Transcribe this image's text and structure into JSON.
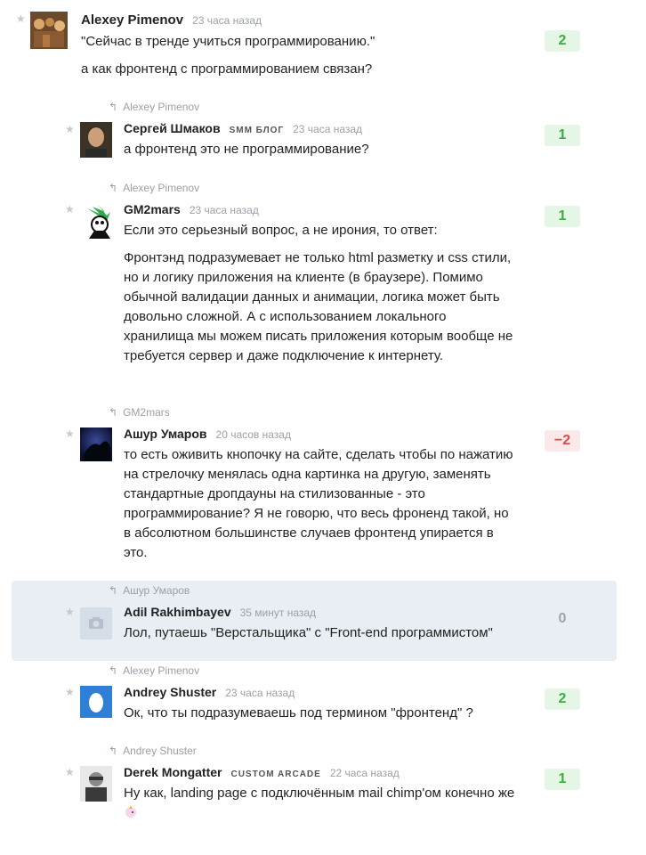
{
  "comments": [
    {
      "author": "Alexey Pimenov",
      "time": "23 часа назад",
      "score": "2",
      "p1": "\"Сейчас в тренде учиться программированию.\"",
      "p2": "а как фронтенд с программированием связан?"
    },
    {
      "reply_to": "Alexey Pimenov",
      "author": "Сергей Шмаков",
      "blog": "SMM БЛОГ",
      "time": "23 часа назад",
      "score": "1",
      "p1": "а фронтенд это не программирование?"
    },
    {
      "reply_to": "Alexey Pimenov",
      "author": "GM2mars",
      "time": "23 часа назад",
      "score": "1",
      "p1": "Если это серьезный вопрос, а не ирония, то ответ:",
      "p2": "Фронтэнд подразумевает не только html разметку и css стили, но и логику приложения на клиенте (в браузере). Помимо обычной валидации данных и анимации, логика может быть довольно сложной. А с использованием локального хранилища мы можем писать приложения которым вообще не требуется сервер и даже подключение к интернету."
    },
    {
      "reply_to": "GM2mars",
      "author": "Ашур Умаров",
      "time": "20 часов назад",
      "score": "−2",
      "p1": "то есть оживить кнопочку на сайте, сделать чтобы по нажатию на стрелочку менялась одна картинка на другую, заменять стандартные дропдауны на стилизованные - это программирование? Я не говорю, что весь фроненд такой, но в абсолютном большинстве случаев фронтенд упирается в это."
    },
    {
      "reply_to": "Ашур Умаров",
      "author": "Adil Rakhimbayev",
      "time": "35 минут назад",
      "score": "0",
      "p1": "Лол, путаешь \"Верстальщика\" с \"Front-end программистом\""
    },
    {
      "reply_to": "Alexey Pimenov",
      "author": "Andrey Shuster",
      "time": "23 часа назад",
      "score": "2",
      "p1": "Ок, что ты подразумеваешь под термином \"фронтенд\" ?"
    },
    {
      "reply_to": "Andrey Shuster",
      "author": "Derek Mongatter",
      "blog": "CUSTOM ARCADE",
      "time": "22 часа назад",
      "score": "1",
      "p1": "Ну как, landing page с подключённым mail chimp'ом конечно же"
    }
  ],
  "colors": {
    "positive": "#3cae3c",
    "negative": "#e0494c",
    "highlight": "#e8eef4"
  }
}
